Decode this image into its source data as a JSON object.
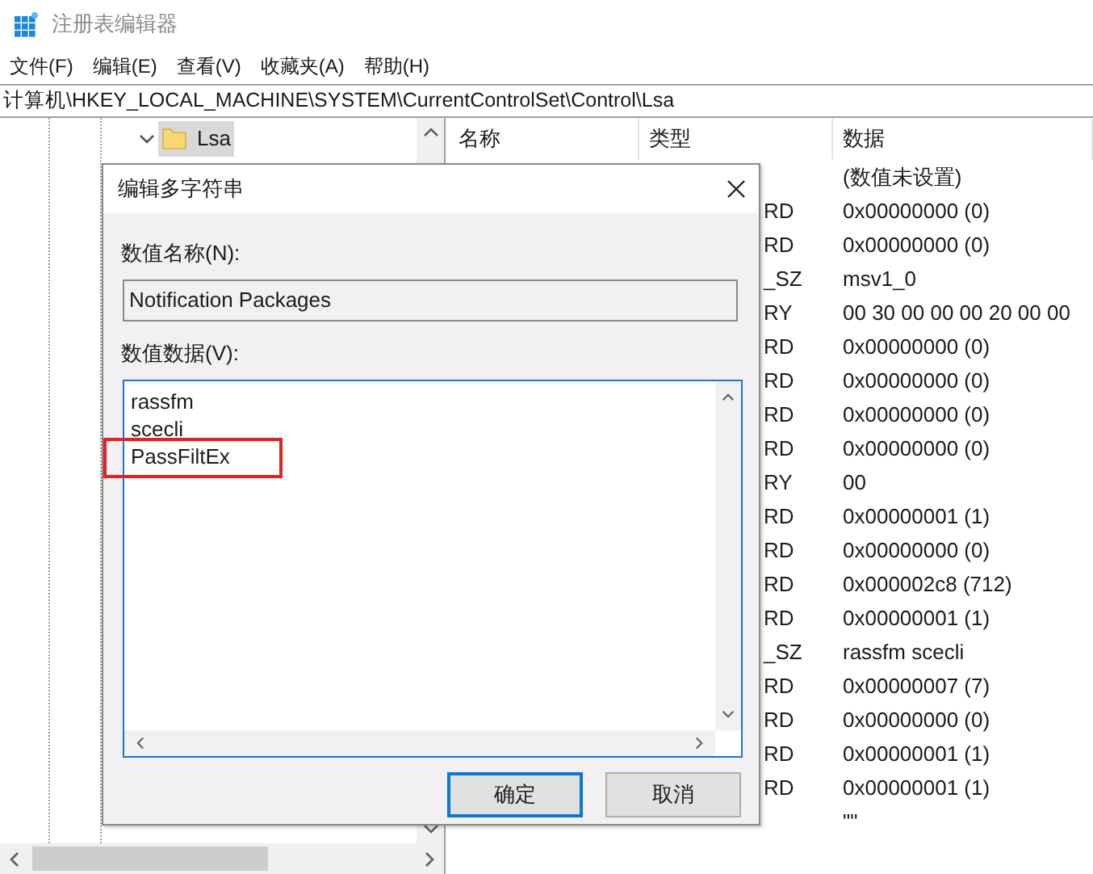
{
  "window": {
    "title": "注册表编辑器"
  },
  "menu": [
    "文件(F)",
    "编辑(E)",
    "查看(V)",
    "收藏夹(A)",
    "帮助(H)"
  ],
  "address": "计算机\\HKEY_LOCAL_MACHINE\\SYSTEM\\CurrentControlSet\\Control\\Lsa",
  "tree": {
    "items": [
      {
        "label": "Lsa",
        "selected": true,
        "expanded": true
      }
    ]
  },
  "table": {
    "columns": [
      "名称",
      "类型",
      "数据"
    ],
    "rows": [
      {
        "type": "",
        "data": "(数值未设置)"
      },
      {
        "type": "RD",
        "data": "0x00000000 (0)"
      },
      {
        "type": "RD",
        "data": "0x00000000 (0)"
      },
      {
        "type": "_SZ",
        "data": "msv1_0"
      },
      {
        "type": "RY",
        "data": "00 30 00 00 00 20 00 00"
      },
      {
        "type": "RD",
        "data": "0x00000000 (0)"
      },
      {
        "type": "RD",
        "data": "0x00000000 (0)"
      },
      {
        "type": "RD",
        "data": "0x00000000 (0)"
      },
      {
        "type": "RD",
        "data": "0x00000000 (0)"
      },
      {
        "type": "RY",
        "data": "00"
      },
      {
        "type": "RD",
        "data": "0x00000001 (1)"
      },
      {
        "type": "RD",
        "data": "0x00000000 (0)"
      },
      {
        "type": "RD",
        "data": "0x000002c8 (712)"
      },
      {
        "type": "RD",
        "data": "0x00000001 (1)"
      },
      {
        "type": "_SZ",
        "data": "rassfm scecli"
      },
      {
        "type": "RD",
        "data": "0x00000007 (7)"
      },
      {
        "type": "RD",
        "data": "0x00000000 (0)"
      },
      {
        "type": "RD",
        "data": "0x00000001 (1)"
      },
      {
        "type": "RD",
        "data": "0x00000001 (1)"
      },
      {
        "type": "",
        "data": "\"\""
      }
    ]
  },
  "dialog": {
    "title": "编辑多字符串",
    "name_label": "数值名称(N):",
    "name_value": "Notification Packages",
    "data_label": "数值数据(V):",
    "lines": [
      {
        "text": "rassfm",
        "annotated": false
      },
      {
        "text": "scecli",
        "annotated": false
      },
      {
        "text": "PassFiltEx",
        "annotated": true
      }
    ],
    "buttons": [
      {
        "label": "确定",
        "default": true
      },
      {
        "label": "取消",
        "default": false
      }
    ]
  }
}
